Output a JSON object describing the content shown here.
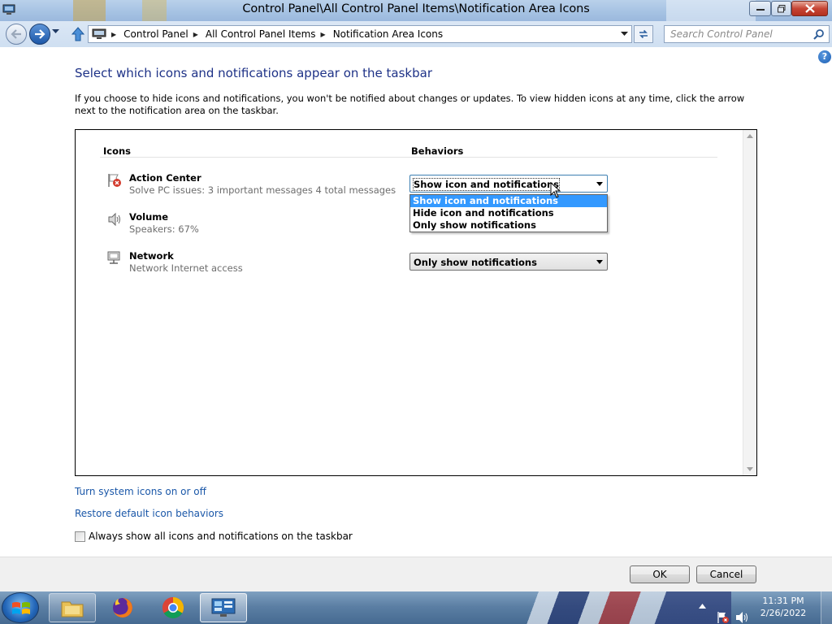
{
  "window": {
    "title": "Control Panel\\All Control Panel Items\\Notification Area Icons"
  },
  "address": {
    "crumbs": [
      "Control Panel",
      "All Control Panel Items",
      "Notification Area Icons"
    ],
    "search_placeholder": "Search Control Panel"
  },
  "page": {
    "heading": "Select which icons and notifications appear on the taskbar",
    "description": "If you choose to hide icons and notifications, you won't be notified about changes or updates. To view hidden icons at any time, click the arrow next to the notification area on the taskbar.",
    "col_icons": "Icons",
    "col_behaviors": "Behaviors"
  },
  "rows": [
    {
      "name": "Action Center",
      "detail": "Solve PC issues: 3 important messages  4 total messages",
      "icon": "action-center-flag-icon",
      "behavior": "Show icon and notifications"
    },
    {
      "name": "Volume",
      "detail": "Speakers: 67%",
      "icon": "speaker-icon",
      "behavior": ""
    },
    {
      "name": "Network",
      "detail": "Network  Internet access",
      "icon": "network-icon",
      "behavior": "Only show notifications"
    }
  ],
  "dropdown": {
    "options": [
      "Show icon and notifications",
      "Hide icon and notifications",
      "Only show notifications"
    ],
    "selected_index": 0
  },
  "links": {
    "system_icons": "Turn system icons on or off",
    "restore": "Restore default icon behaviors"
  },
  "always_show": {
    "label": "Always show all icons and notifications on the taskbar",
    "checked": false
  },
  "buttons": {
    "ok": "OK",
    "cancel": "Cancel"
  },
  "taskbar": {
    "apps": [
      "explorer-icon",
      "firefox-icon",
      "chrome-icon",
      "control-panel-icon"
    ],
    "time": "11:31 PM",
    "date": "2/26/2022"
  },
  "colors": {
    "heading": "#1e3287",
    "link": "#1a57a8",
    "selection": "#3399ff"
  }
}
